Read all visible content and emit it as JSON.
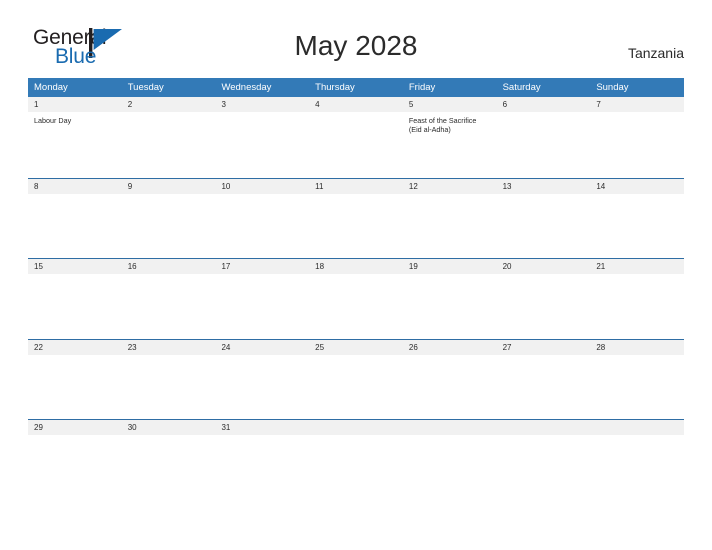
{
  "brand": {
    "name_part1": "General",
    "name_part2": "Blue",
    "flag_icon": "flag-triangle-icon",
    "color_dark": "#231f20",
    "color_blue": "#1a6bb0"
  },
  "header": {
    "title": "May 2028",
    "country": "Tanzania"
  },
  "calendar": {
    "accent_color": "#337ab7",
    "band_color": "#f1f1f1",
    "weekdays": [
      "Monday",
      "Tuesday",
      "Wednesday",
      "Thursday",
      "Friday",
      "Saturday",
      "Sunday"
    ],
    "weeks": [
      {
        "days": [
          {
            "date": "1",
            "event": "Labour Day"
          },
          {
            "date": "2",
            "event": ""
          },
          {
            "date": "3",
            "event": ""
          },
          {
            "date": "4",
            "event": ""
          },
          {
            "date": "5",
            "event": "Feast of the Sacrifice (Eid al-Adha)"
          },
          {
            "date": "6",
            "event": ""
          },
          {
            "date": "7",
            "event": ""
          }
        ]
      },
      {
        "days": [
          {
            "date": "8",
            "event": ""
          },
          {
            "date": "9",
            "event": ""
          },
          {
            "date": "10",
            "event": ""
          },
          {
            "date": "11",
            "event": ""
          },
          {
            "date": "12",
            "event": ""
          },
          {
            "date": "13",
            "event": ""
          },
          {
            "date": "14",
            "event": ""
          }
        ]
      },
      {
        "days": [
          {
            "date": "15",
            "event": ""
          },
          {
            "date": "16",
            "event": ""
          },
          {
            "date": "17",
            "event": ""
          },
          {
            "date": "18",
            "event": ""
          },
          {
            "date": "19",
            "event": ""
          },
          {
            "date": "20",
            "event": ""
          },
          {
            "date": "21",
            "event": ""
          }
        ]
      },
      {
        "days": [
          {
            "date": "22",
            "event": ""
          },
          {
            "date": "23",
            "event": ""
          },
          {
            "date": "24",
            "event": ""
          },
          {
            "date": "25",
            "event": ""
          },
          {
            "date": "26",
            "event": ""
          },
          {
            "date": "27",
            "event": ""
          },
          {
            "date": "28",
            "event": ""
          }
        ]
      },
      {
        "days": [
          {
            "date": "29",
            "event": ""
          },
          {
            "date": "30",
            "event": ""
          },
          {
            "date": "31",
            "event": ""
          },
          {
            "date": "",
            "event": ""
          },
          {
            "date": "",
            "event": ""
          },
          {
            "date": "",
            "event": ""
          },
          {
            "date": "",
            "event": ""
          }
        ]
      }
    ]
  }
}
